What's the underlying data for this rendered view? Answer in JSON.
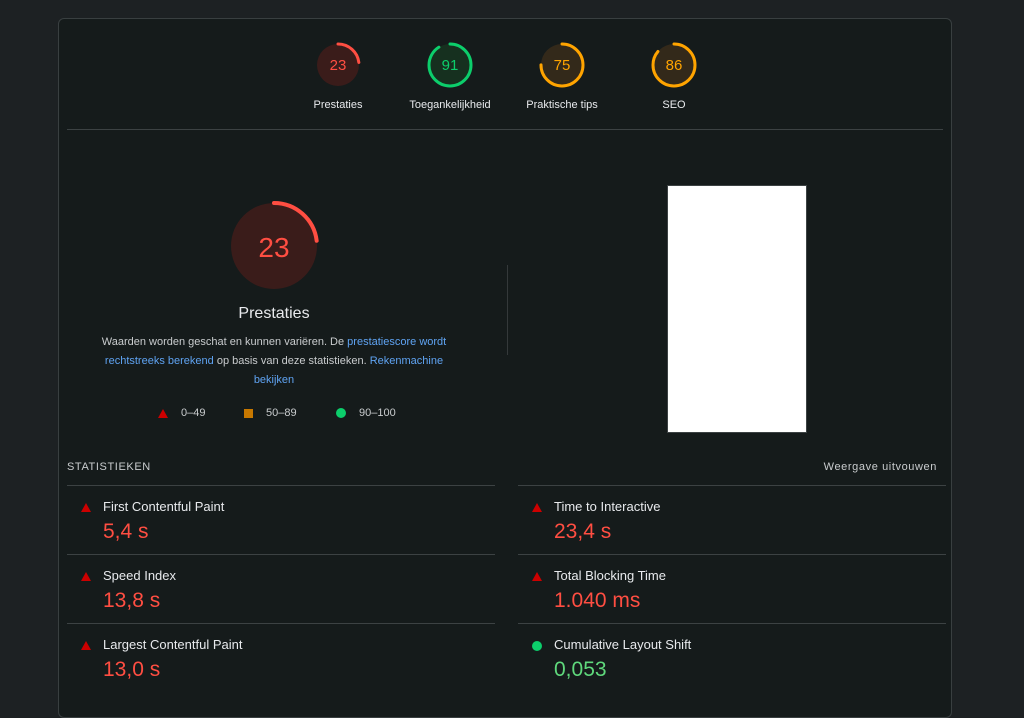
{
  "categories": [
    {
      "label": "Prestaties",
      "score": "23",
      "level": "fail",
      "fraction": 0.23
    },
    {
      "label": "Toegankelijkheid",
      "score": "91",
      "level": "pass",
      "fraction": 0.91
    },
    {
      "label": "Praktische tips",
      "score": "75",
      "level": "average",
      "fraction": 0.75
    },
    {
      "label": "SEO",
      "score": "86",
      "level": "average",
      "fraction": 0.86
    }
  ],
  "performance": {
    "score": "23",
    "fraction": 0.23,
    "title": "Prestaties",
    "desc_part1": "Waarden worden geschat en kunnen variëren. De ",
    "link1": "prestatiescore wordt rechtstreeks berekend",
    "desc_part2": " op basis van deze statistieken. ",
    "link2": "Rekenmachine bekijken"
  },
  "legend": {
    "fail": "0–49",
    "average": "50–89",
    "pass": "90–100"
  },
  "metrics_header": {
    "title": "STATISTIEKEN",
    "expand": "Weergave uitvouwen"
  },
  "metrics": [
    {
      "name": "First Contentful Paint",
      "value": "5,4 s",
      "status": "fail"
    },
    {
      "name": "Time to Interactive",
      "value": "23,4 s",
      "status": "fail"
    },
    {
      "name": "Speed Index",
      "value": "13,8 s",
      "status": "fail"
    },
    {
      "name": "Total Blocking Time",
      "value": "1.040 ms",
      "status": "fail"
    },
    {
      "name": "Largest Contentful Paint",
      "value": "13,0 s",
      "status": "fail"
    },
    {
      "name": "Cumulative Layout Shift",
      "value": "0,053",
      "status": "pass"
    }
  ],
  "colors": {
    "fail": "#ff4e42",
    "fail_bg": "#3a1c1a",
    "average": "#ffa400",
    "average_bg": "#33291a",
    "pass": "#0cce6b",
    "pass_bg": "#16301f",
    "fail_icon": "#cc0000",
    "average_icon": "#c77800"
  }
}
